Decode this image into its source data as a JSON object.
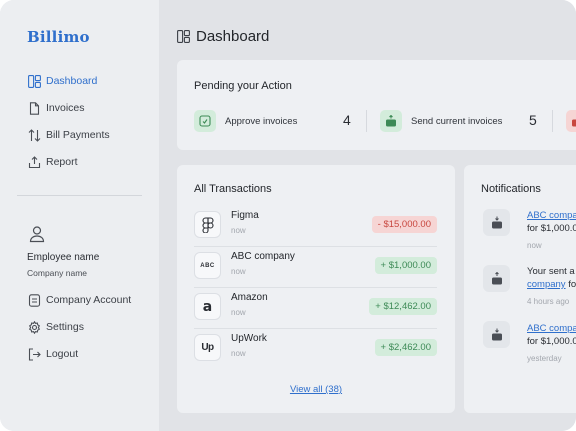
{
  "brand": {
    "name": "Billimo",
    "color": "#2f6fcc"
  },
  "sidebar": {
    "items": [
      {
        "label": "Dashboard",
        "icon": "dashboard-icon",
        "active": true
      },
      {
        "label": "Invoices",
        "icon": "invoice-icon"
      },
      {
        "label": "Bill Payments",
        "icon": "arrows-updown-icon"
      },
      {
        "label": "Report",
        "icon": "report-icon"
      }
    ],
    "user": {
      "name": "Employee name",
      "company": "Company name"
    },
    "bottom_items": [
      {
        "label": "Company Account",
        "icon": "company-account-icon"
      },
      {
        "label": "Settings",
        "icon": "gear-icon"
      },
      {
        "label": "Logout",
        "icon": "logout-icon"
      }
    ]
  },
  "header": {
    "title": "Dashboard"
  },
  "pending": {
    "title": "Pending your Action",
    "items": [
      {
        "label": "Approve invoices",
        "count": "4",
        "icon": "approve-icon"
      },
      {
        "label": "Send current invoices",
        "count": "5",
        "icon": "send-invoice-icon"
      }
    ]
  },
  "transactions": {
    "title": "All Transactions",
    "rows": [
      {
        "name": "Figma",
        "time": "now",
        "amount": "- $15,000.00",
        "type": "negative",
        "logo": "figma-logo"
      },
      {
        "name": "ABC company",
        "time": "now",
        "amount": "+ $1,000.00",
        "type": "positive",
        "logo_text": "ABC"
      },
      {
        "name": "Amazon",
        "time": "now",
        "amount": "+ $12,462.00",
        "type": "positive",
        "logo_text": "a"
      },
      {
        "name": "UpWork",
        "time": "now",
        "amount": "+ $2,462.00",
        "type": "positive",
        "logo_text": "Up"
      }
    ],
    "view_all": "View all (38)"
  },
  "notifications": {
    "title": "Notifications",
    "items": [
      {
        "link": "ABC compa",
        "text": "for $1,000.0",
        "time": "now"
      },
      {
        "pre": "Your sent a",
        "link": "company",
        "post": " fo",
        "time": "4 hours ago"
      },
      {
        "link": "ABC compa",
        "text": "for $1,000.0",
        "time": "yesterday"
      }
    ]
  }
}
